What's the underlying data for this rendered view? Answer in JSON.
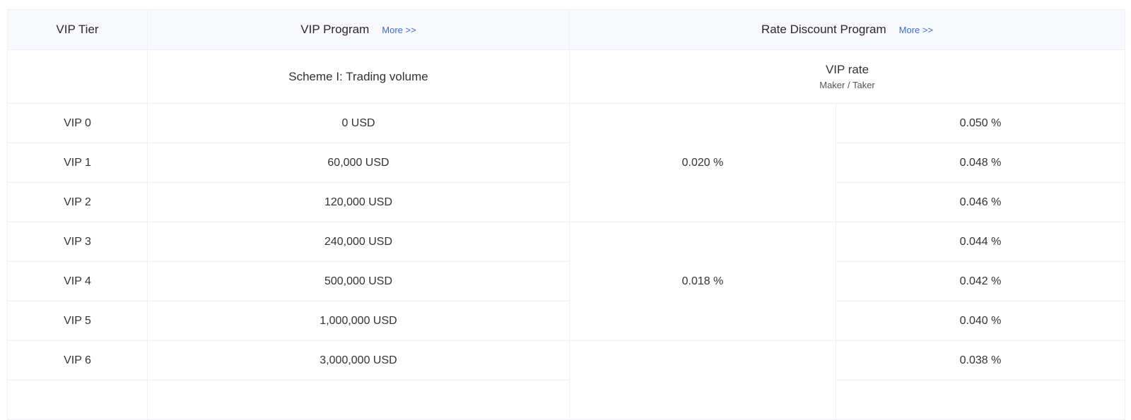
{
  "header": {
    "col_tier": "VIP Tier",
    "col_program": "VIP Program",
    "col_program_more": "More >>",
    "col_discount": "Rate Discount Program",
    "col_discount_more": "More >>"
  },
  "subheader": {
    "scheme": "Scheme I: Trading volume",
    "rate_title": "VIP rate",
    "rate_note": "Maker / Taker"
  },
  "rows": [
    {
      "tier": "VIP 0",
      "volume": "0 USD",
      "taker": "0.050 %"
    },
    {
      "tier": "VIP 1",
      "volume": "60,000 USD",
      "taker": "0.048 %"
    },
    {
      "tier": "VIP 2",
      "volume": "120,000 USD",
      "taker": "0.046 %"
    },
    {
      "tier": "VIP 3",
      "volume": "240,000 USD",
      "taker": "0.044 %"
    },
    {
      "tier": "VIP 4",
      "volume": "500,000 USD",
      "taker": "0.042 %"
    },
    {
      "tier": "VIP 5",
      "volume": "1,000,000 USD",
      "taker": "0.040 %"
    },
    {
      "tier": "VIP 6",
      "volume": "3,000,000 USD",
      "taker": "0.038 %"
    }
  ],
  "maker_groups": [
    {
      "value": "0.020 %"
    },
    {
      "value": "0.018 %"
    },
    {
      "value": ""
    }
  ]
}
